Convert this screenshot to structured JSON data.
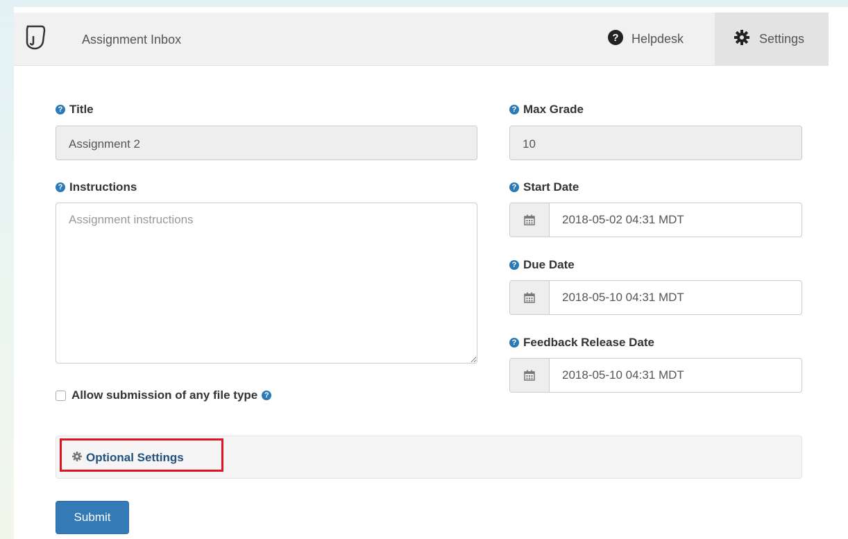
{
  "navbar": {
    "brand": "Assignment Inbox",
    "helpdesk_label": "Helpdesk",
    "settings_label": "Settings"
  },
  "form": {
    "title": {
      "label": "Title",
      "value": "Assignment 2"
    },
    "max_grade": {
      "label": "Max Grade",
      "value": "10"
    },
    "instructions": {
      "label": "Instructions",
      "placeholder": "Assignment instructions"
    },
    "start_date": {
      "label": "Start Date",
      "value": "2018-05-02 04:31 MDT"
    },
    "due_date": {
      "label": "Due Date",
      "value": "2018-05-10 04:31 MDT"
    },
    "feedback_release_date": {
      "label": "Feedback Release Date",
      "value": "2018-05-10 04:31 MDT"
    },
    "allow_any_file": {
      "label": "Allow submission of any file type",
      "checked": false
    },
    "optional_settings_label": "Optional Settings",
    "submit_label": "Submit"
  },
  "icons": {
    "logo": "page-curl-logo-icon",
    "help": "question-circle-icon",
    "settings": "gear-icon",
    "calendar": "calendar-icon"
  },
  "colors": {
    "primary": "#337ab7",
    "link": "#23527c",
    "help_icon": "#2a7ab8",
    "highlight": "#e0141e"
  }
}
